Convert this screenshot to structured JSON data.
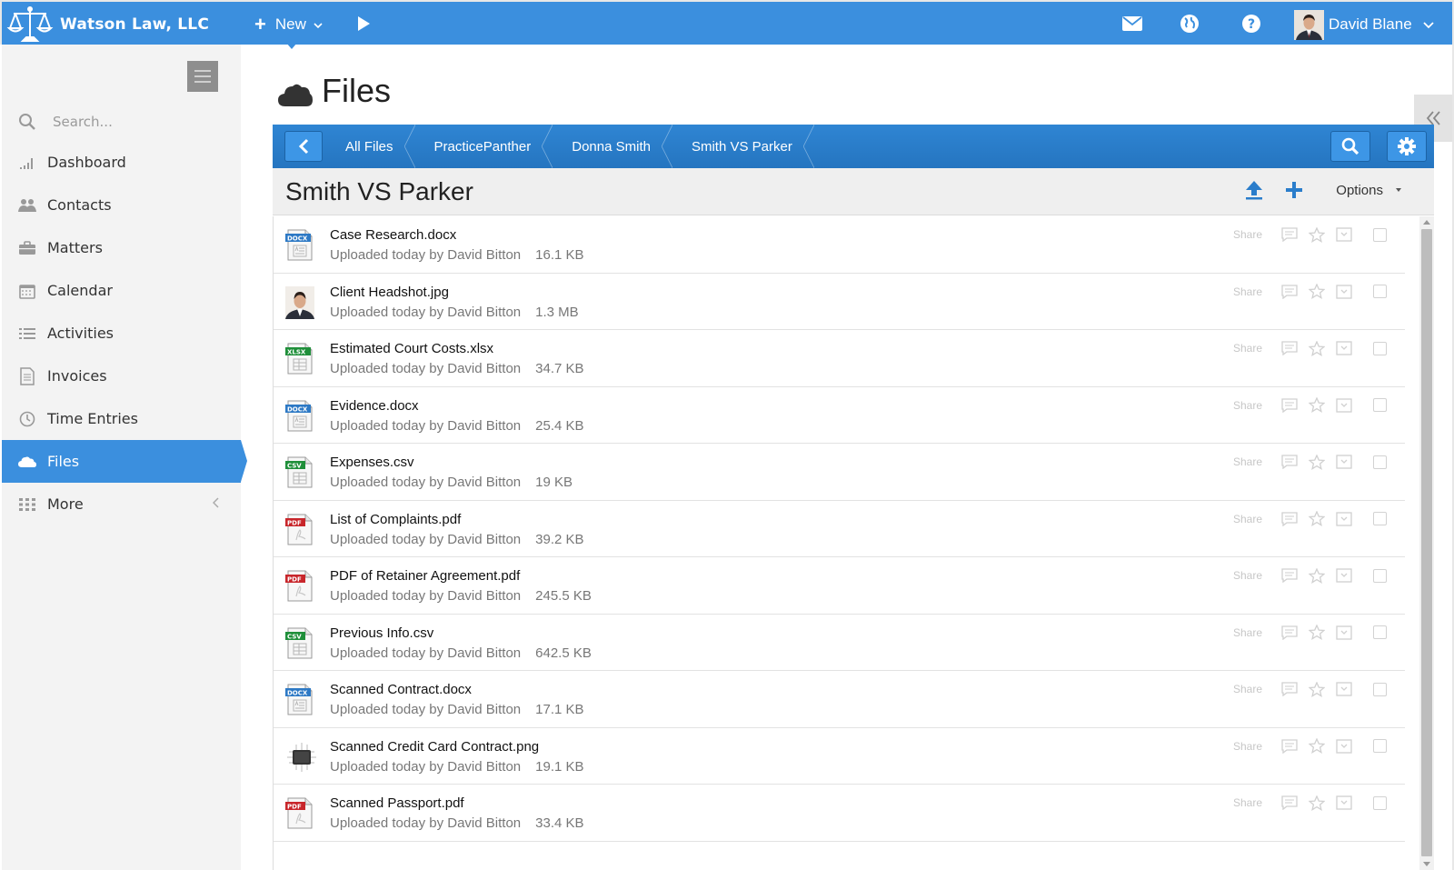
{
  "app": {
    "brand_name": "Watson Law, LLC",
    "new_label": "New",
    "user_name": "David Blane"
  },
  "colors": {
    "primary": "#3b8fde",
    "breadcrumb_bar": "#2a7dcb",
    "sidebar_bg": "#f3f3f3"
  },
  "sidebar": {
    "search_placeholder": "Search...",
    "items": [
      {
        "label": "Dashboard",
        "icon": "bar-chart-icon"
      },
      {
        "label": "Contacts",
        "icon": "users-icon"
      },
      {
        "label": "Matters",
        "icon": "briefcase-icon"
      },
      {
        "label": "Calendar",
        "icon": "calendar-icon"
      },
      {
        "label": "Activities",
        "icon": "list-icon"
      },
      {
        "label": "Invoices",
        "icon": "document-icon"
      },
      {
        "label": "Time Entries",
        "icon": "clock-icon"
      },
      {
        "label": "Files",
        "icon": "cloud-icon",
        "active": true
      },
      {
        "label": "More",
        "icon": "grid-icon"
      }
    ]
  },
  "page": {
    "title": "Files"
  },
  "breadcrumb": {
    "items": [
      "All Files",
      "PracticePanther",
      "Donna Smith",
      "Smith VS Parker"
    ]
  },
  "folder": {
    "title": "Smith VS Parker",
    "options_label": "Options"
  },
  "files": {
    "share_label": "Share",
    "rows": [
      {
        "name": "Case Research.docx",
        "meta": "Uploaded today by David Bitton",
        "size": "16.1 KB",
        "type": "DOCX"
      },
      {
        "name": "Client Headshot.jpg",
        "meta": "Uploaded today by David Bitton",
        "size": "1.3 MB",
        "type": "IMAGE"
      },
      {
        "name": "Estimated Court Costs.xlsx",
        "meta": "Uploaded today by David Bitton",
        "size": "34.7 KB",
        "type": "XLSX"
      },
      {
        "name": "Evidence.docx",
        "meta": "Uploaded today by David Bitton",
        "size": "25.4 KB",
        "type": "DOCX"
      },
      {
        "name": "Expenses.csv",
        "meta": "Uploaded today by David Bitton",
        "size": "19 KB",
        "type": "CSV"
      },
      {
        "name": "List of Complaints.pdf",
        "meta": "Uploaded today by David Bitton",
        "size": "39.2 KB",
        "type": "PDF"
      },
      {
        "name": "PDF of Retainer Agreement.pdf",
        "meta": "Uploaded today by David Bitton",
        "size": "245.5 KB",
        "type": "PDF"
      },
      {
        "name": "Previous Info.csv",
        "meta": "Uploaded today by David Bitton",
        "size": "642.5 KB",
        "type": "CSV"
      },
      {
        "name": "Scanned Contract.docx",
        "meta": "Uploaded today by David Bitton",
        "size": "17.1 KB",
        "type": "DOCX"
      },
      {
        "name": "Scanned Credit Card Contract.png",
        "meta": "Uploaded today by David Bitton",
        "size": "19.1 KB",
        "type": "CHIP"
      },
      {
        "name": "Scanned Passport.pdf",
        "meta": "Uploaded today by David Bitton",
        "size": "33.4 KB",
        "type": "PDF"
      }
    ]
  }
}
